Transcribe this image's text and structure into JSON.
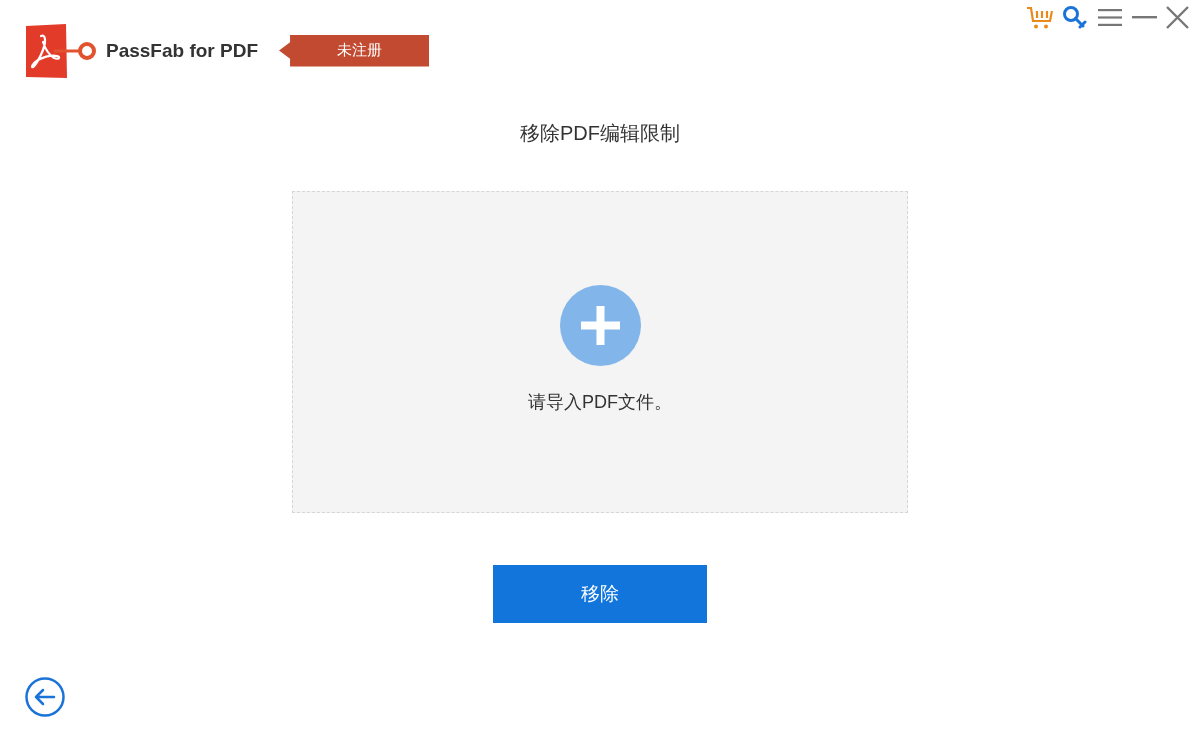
{
  "app": {
    "name": "PassFab for PDF",
    "badge": "未注册"
  },
  "page": {
    "title": "移除PDF编辑限制"
  },
  "drop_zone": {
    "prompt": "请导入PDF文件。"
  },
  "action_button": {
    "label": "移除"
  }
}
